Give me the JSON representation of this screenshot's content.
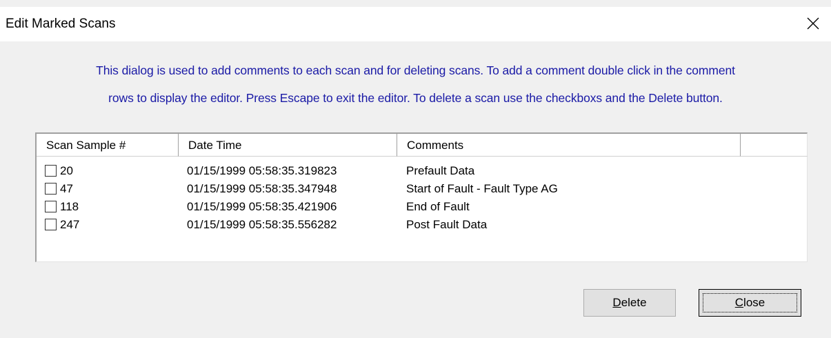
{
  "window": {
    "title": "Edit Marked Scans",
    "close_icon": "close-icon"
  },
  "description": {
    "line1": "This dialog is used to add comments to each scan and for deleting scans. To add a comment double click in the comment",
    "line2": "rows to display the editor. Press Escape to exit the editor. To delete a scan use the checkboxs and the Delete button."
  },
  "table": {
    "headers": [
      "Scan Sample #",
      "Date Time",
      "Comments",
      ""
    ],
    "rows": [
      {
        "scan": "20",
        "datetime": "01/15/1999 05:58:35.319823",
        "comment": "Prefault Data",
        "checked": false
      },
      {
        "scan": "47",
        "datetime": "01/15/1999 05:58:35.347948",
        "comment": "Start of Fault - Fault Type AG",
        "checked": false
      },
      {
        "scan": "118",
        "datetime": "01/15/1999 05:58:35.421906",
        "comment": "End of Fault",
        "checked": false
      },
      {
        "scan": "247",
        "datetime": "01/15/1999 05:58:35.556282",
        "comment": "Post Fault Data",
        "checked": false
      }
    ]
  },
  "buttons": {
    "delete": {
      "accel": "D",
      "rest": "elete"
    },
    "close": {
      "accel": "C",
      "rest": "lose"
    }
  },
  "colors": {
    "description_text": "#1a1aa6",
    "background": "#f0f0f0"
  }
}
